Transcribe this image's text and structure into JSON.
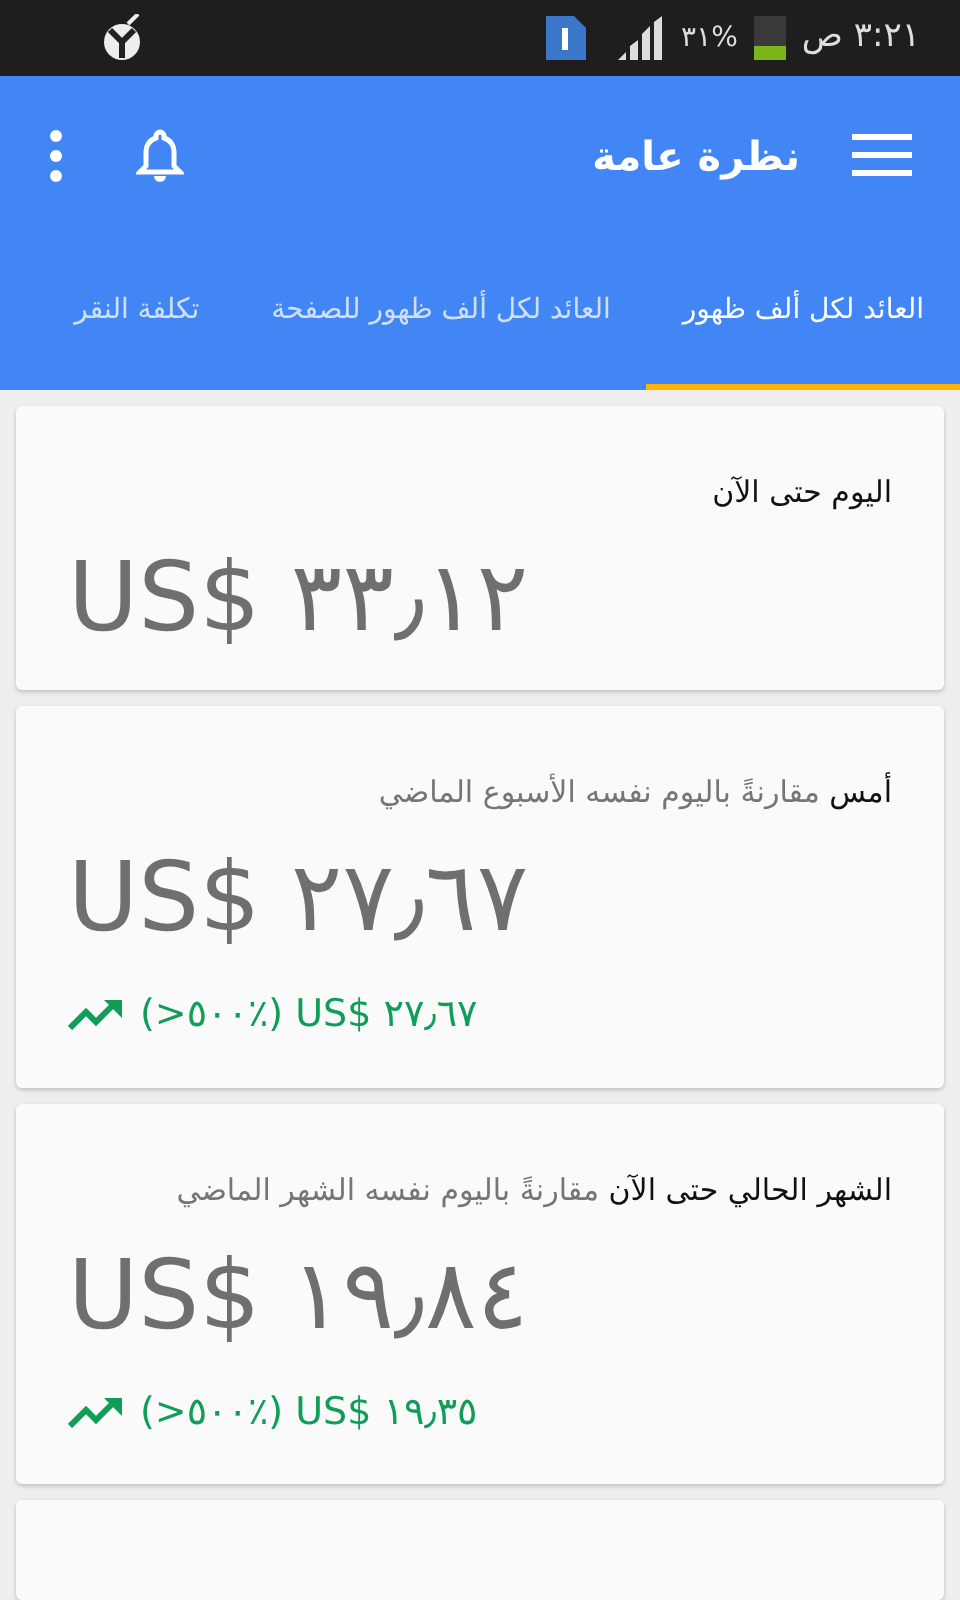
{
  "status_bar": {
    "time": "٣:٢١ ص",
    "battery": "٣١%"
  },
  "app_bar": {
    "title": "نظرة عامة"
  },
  "tabs": [
    {
      "label": "العائد لكل ألف ظهور",
      "selected": true
    },
    {
      "label": "العائد لكل ألف ظهور للصفحة",
      "selected": false
    },
    {
      "label": "تكلفة النقر",
      "selected": false
    }
  ],
  "cards": [
    {
      "heading": "اليوم حتى الآن",
      "amount": "US$ ٣٣٫١٢"
    },
    {
      "heading": "**أمس** مقارنةً باليوم نفسه الأسبوع الماضي",
      "amount": "US$ ٢٧٫٦٧",
      "change": "(>٥٠٠٪) US$ ٢٧٫٦٧"
    },
    {
      "heading": "**الشهر الحالي حتى الآن** مقارنةً باليوم نفسه الشهر الماضي",
      "amount": "US$ ١٩٫٨٤",
      "change": "(>٥٠٠٪) US$ ١٩٫٣٥"
    }
  ]
}
